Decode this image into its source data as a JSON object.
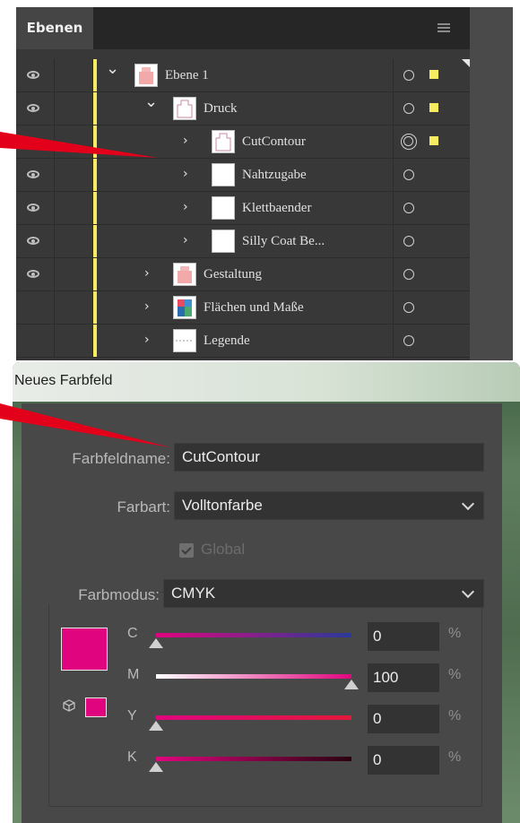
{
  "layers_panel": {
    "tab_label": "Ebenen",
    "rows": [
      {
        "name": "Ebene 1",
        "visible": true,
        "level": 0,
        "expanded": true,
        "thumb": "pink-figure",
        "target": "single",
        "selected": true,
        "corner": true
      },
      {
        "name": "Druck",
        "visible": true,
        "level": 1,
        "expanded": true,
        "thumb": "outline-figure",
        "target": "single",
        "selected": true
      },
      {
        "name": "CutContour",
        "visible": false,
        "level": 2,
        "expanded": false,
        "thumb": "outline-figure",
        "target": "double",
        "selected": true
      },
      {
        "name": "Nahtzugabe",
        "visible": true,
        "level": 2,
        "expanded": false,
        "thumb": "white",
        "target": "single",
        "selected": false
      },
      {
        "name": "Klettbaender",
        "visible": true,
        "level": 2,
        "expanded": false,
        "thumb": "white",
        "target": "single",
        "selected": false
      },
      {
        "name": "Silly Coat Be...",
        "visible": true,
        "level": 2,
        "expanded": false,
        "thumb": "white",
        "target": "single",
        "selected": false
      },
      {
        "name": "Gestaltung",
        "visible": true,
        "level": 1,
        "expanded": false,
        "thumb": "pink-figure",
        "target": "single",
        "selected": false
      },
      {
        "name": "Flächen und Maße",
        "visible": false,
        "level": 1,
        "expanded": false,
        "thumb": "color-figure",
        "target": "single",
        "selected": false
      },
      {
        "name": "Legende",
        "visible": false,
        "level": 1,
        "expanded": false,
        "thumb": "legend",
        "target": "single",
        "selected": false
      }
    ]
  },
  "dialog": {
    "title": "Neues Farbfeld",
    "name_label": "Farbfeldname:",
    "name_value": "CutContour",
    "type_label": "Farbart:",
    "type_value": "Volltonfarbe",
    "global_label": "Global",
    "global_checked": true,
    "mode_label": "Farbmodus:",
    "mode_value": "CMYK",
    "swatch_color": "#e0057e",
    "channels": [
      {
        "label": "C",
        "value": "0",
        "unit": "%",
        "level": 0
      },
      {
        "label": "M",
        "value": "100",
        "unit": "%",
        "level": 100
      },
      {
        "label": "Y",
        "value": "0",
        "unit": "%",
        "level": 0
      },
      {
        "label": "K",
        "value": "0",
        "unit": "%",
        "level": 0
      }
    ]
  },
  "colors": {
    "layer_color": "#f6eb61",
    "callout_red": "#e2001a",
    "magenta": "#e0057e"
  }
}
